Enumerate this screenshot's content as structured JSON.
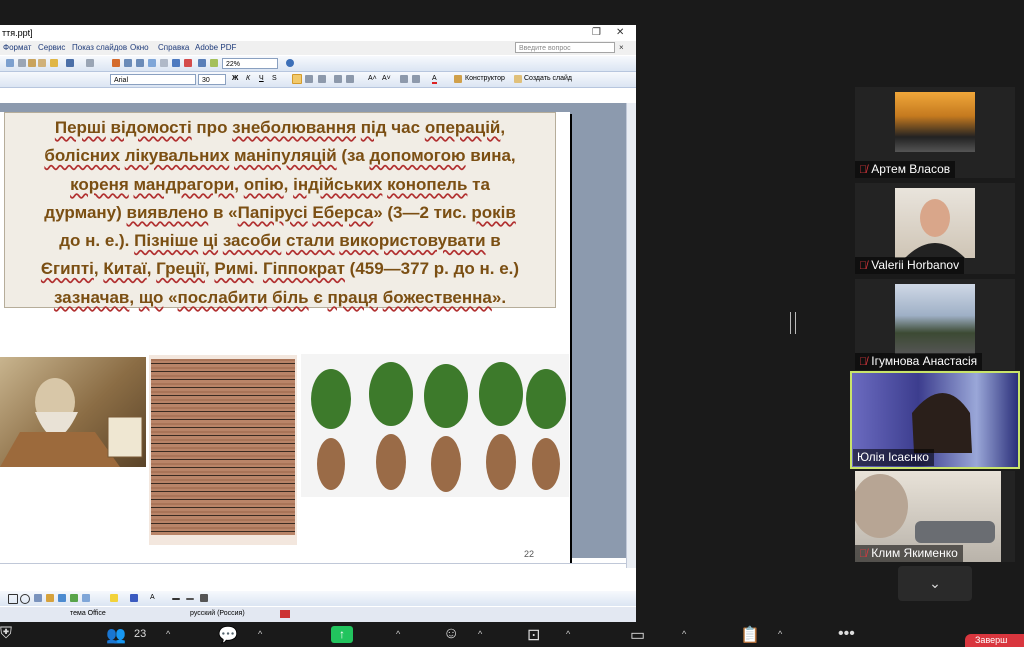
{
  "ppt": {
    "title": "ття.ppt]",
    "menu": [
      "Формат",
      "Сервис",
      "Показ слайдов",
      "Окно",
      "Справка",
      "Adobe PDF"
    ],
    "ask_placeholder": "Введите вопрос",
    "zoom": "22%",
    "font": "Arial",
    "font_size": "30",
    "bold": "Ж",
    "italic": "К",
    "underline": "Ч",
    "shadow": "S",
    "constructor": "Конструктор",
    "new_slide": "Создать слайд",
    "slide_number": "22",
    "status_theme": "тема Office",
    "status_lang": "русский (Россия)"
  },
  "slide": {
    "lines": [
      [
        [
          "Перші",
          1
        ],
        [
          " ",
          0
        ],
        [
          "відомості",
          1
        ],
        [
          " про ",
          0
        ],
        [
          "знеболювання",
          1
        ],
        [
          " ",
          0
        ],
        [
          "під",
          1
        ],
        [
          " час ",
          0
        ],
        [
          "операцій",
          1
        ],
        [
          ",",
          0
        ]
      ],
      [
        [
          "болісних",
          1
        ],
        [
          " ",
          0
        ],
        [
          "лікувальних",
          1
        ],
        [
          " ",
          0
        ],
        [
          "маніпуляцій",
          1
        ],
        [
          " (за ",
          0
        ],
        [
          "допомогою",
          1
        ],
        [
          " вина,",
          0
        ]
      ],
      [
        [
          "кореня",
          1
        ],
        [
          " ",
          0
        ],
        [
          "мандрагори",
          1
        ],
        [
          ", ",
          0
        ],
        [
          "опію",
          1
        ],
        [
          ", ",
          0
        ],
        [
          "індійських",
          1
        ],
        [
          " ",
          0
        ],
        [
          "конопель",
          1
        ],
        [
          " та",
          0
        ]
      ],
      [
        [
          "дурману) ",
          0
        ],
        [
          "виявлено",
          1
        ],
        [
          " в «",
          0
        ],
        [
          "Папірусі",
          1
        ],
        [
          " ",
          0
        ],
        [
          "Еберса",
          1
        ],
        [
          "» (3—2 тис. ",
          0
        ],
        [
          "років",
          1
        ]
      ],
      [
        [
          "до н. е.). ",
          0
        ],
        [
          "Пізніше",
          1
        ],
        [
          " ",
          0
        ],
        [
          "ці",
          1
        ],
        [
          " ",
          0
        ],
        [
          "засоби",
          1
        ],
        [
          " ",
          0
        ],
        [
          "стали",
          1
        ],
        [
          " ",
          0
        ],
        [
          "використовувати",
          1
        ],
        [
          " в",
          0
        ]
      ],
      [
        [
          "Єгипті",
          1
        ],
        [
          ", ",
          0
        ],
        [
          "Китаї",
          1
        ],
        [
          ", ",
          0
        ],
        [
          "Греції",
          1
        ],
        [
          ", ",
          0
        ],
        [
          "Римі",
          1
        ],
        [
          ". ",
          0
        ],
        [
          "Гіппократ",
          1
        ],
        [
          " (459—377 р. до н. е.)",
          0
        ]
      ],
      [
        [
          "зазначав",
          1
        ],
        [
          ", ",
          0
        ],
        [
          "що",
          1
        ],
        [
          " «",
          0
        ],
        [
          "послабити",
          1
        ],
        [
          " ",
          0
        ],
        [
          "біль",
          1
        ],
        [
          " є ",
          0
        ],
        [
          "праця",
          1
        ],
        [
          " ",
          0
        ],
        [
          "божественна",
          1
        ],
        [
          "».",
          0
        ]
      ]
    ]
  },
  "participants": [
    {
      "name": "Артем Власов",
      "active": false
    },
    {
      "name": "Valerii Horbanov",
      "active": false
    },
    {
      "name": "Ігумнова Анастасія",
      "active": false
    },
    {
      "name": "Юлія Ісаєнко",
      "active": true
    },
    {
      "name": "Клим Якименко",
      "active": false
    }
  ],
  "bottom": {
    "participants_count": "23",
    "leave_label": "Заверш"
  },
  "colors": {
    "slide_text": "#7b4f13",
    "active_border": "#c9e46a",
    "share_green": "#22c45e",
    "leave_red": "#d9363e"
  }
}
